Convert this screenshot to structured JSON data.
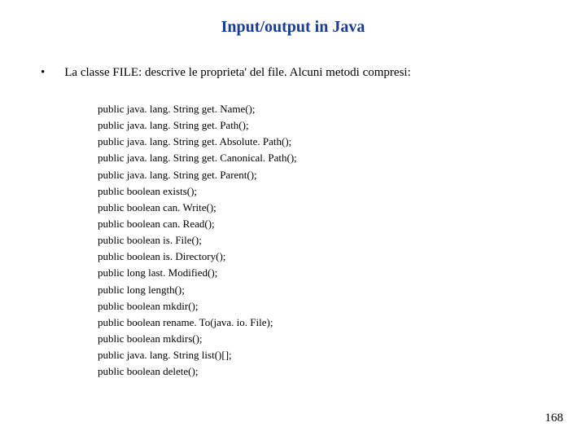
{
  "title": "Input/output in Java",
  "bullet": "•",
  "intro": "La classe FILE: descrive le proprieta' del file. Alcuni metodi compresi:",
  "methods": [
    "public java. lang. String get. Name();",
    "public java. lang. String get. Path();",
    "public java. lang. String get. Absolute. Path();",
    "public java. lang. String get. Canonical. Path();",
    "public java. lang. String get. Parent();",
    "public boolean exists();",
    "public boolean can. Write();",
    "public boolean can. Read();",
    "public boolean is. File();",
    "public boolean is. Directory();",
    "public long last. Modified();",
    "public long length();",
    "public boolean mkdir();",
    "public boolean rename. To(java. io. File);",
    "public boolean mkdirs();",
    "public java. lang. String list()[];",
    "public boolean delete();"
  ],
  "page_number": "168"
}
